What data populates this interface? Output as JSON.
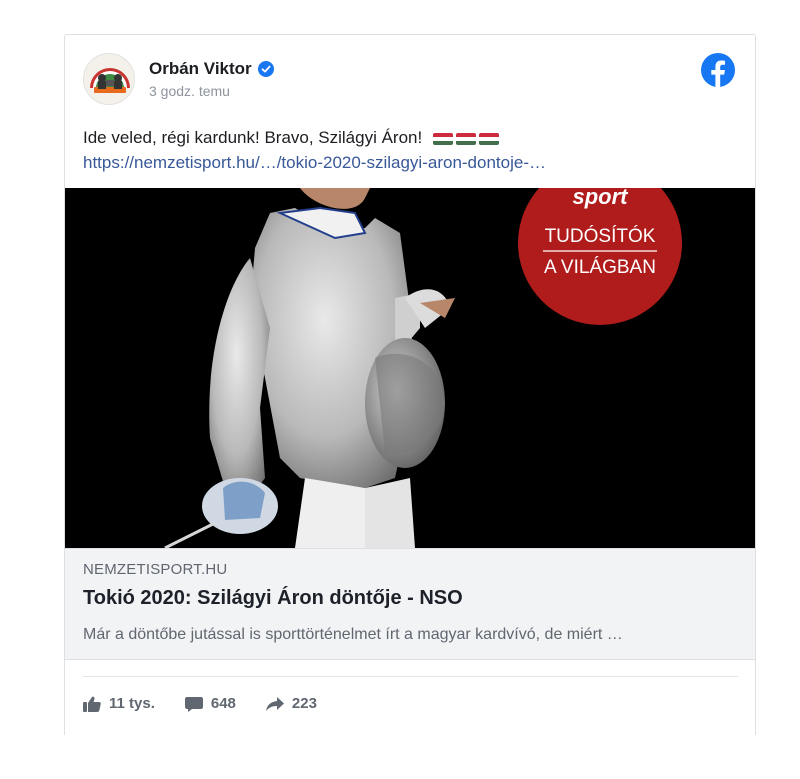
{
  "post": {
    "author": "Orbán Viktor",
    "time": "3 godz. temu",
    "text": "Ide veled, régi kardunk! Bravo, Szilágyi Áron!",
    "link": "https://nemzetisport.hu/…/tokio-2020-szilagyi-aron-dontoje-…"
  },
  "photo": {
    "badge_brand": "sport",
    "badge_line1": "TUDÓSÍTÓK",
    "badge_line2": "A VILÁGBAN"
  },
  "preview": {
    "domain": "NEMZETISPORT.HU",
    "title": "Tokió 2020: Szilágyi Áron döntője - NSO",
    "description": "Már a döntőbe jutással is sporttörténelmet írt a magyar kardvívó, de miért …"
  },
  "stats": {
    "likes": "11 tys.",
    "comments": "648",
    "shares": "223"
  },
  "colors": {
    "facebook_blue": "#1877f2",
    "link": "#385898",
    "badge_red": "#b01c1c"
  }
}
